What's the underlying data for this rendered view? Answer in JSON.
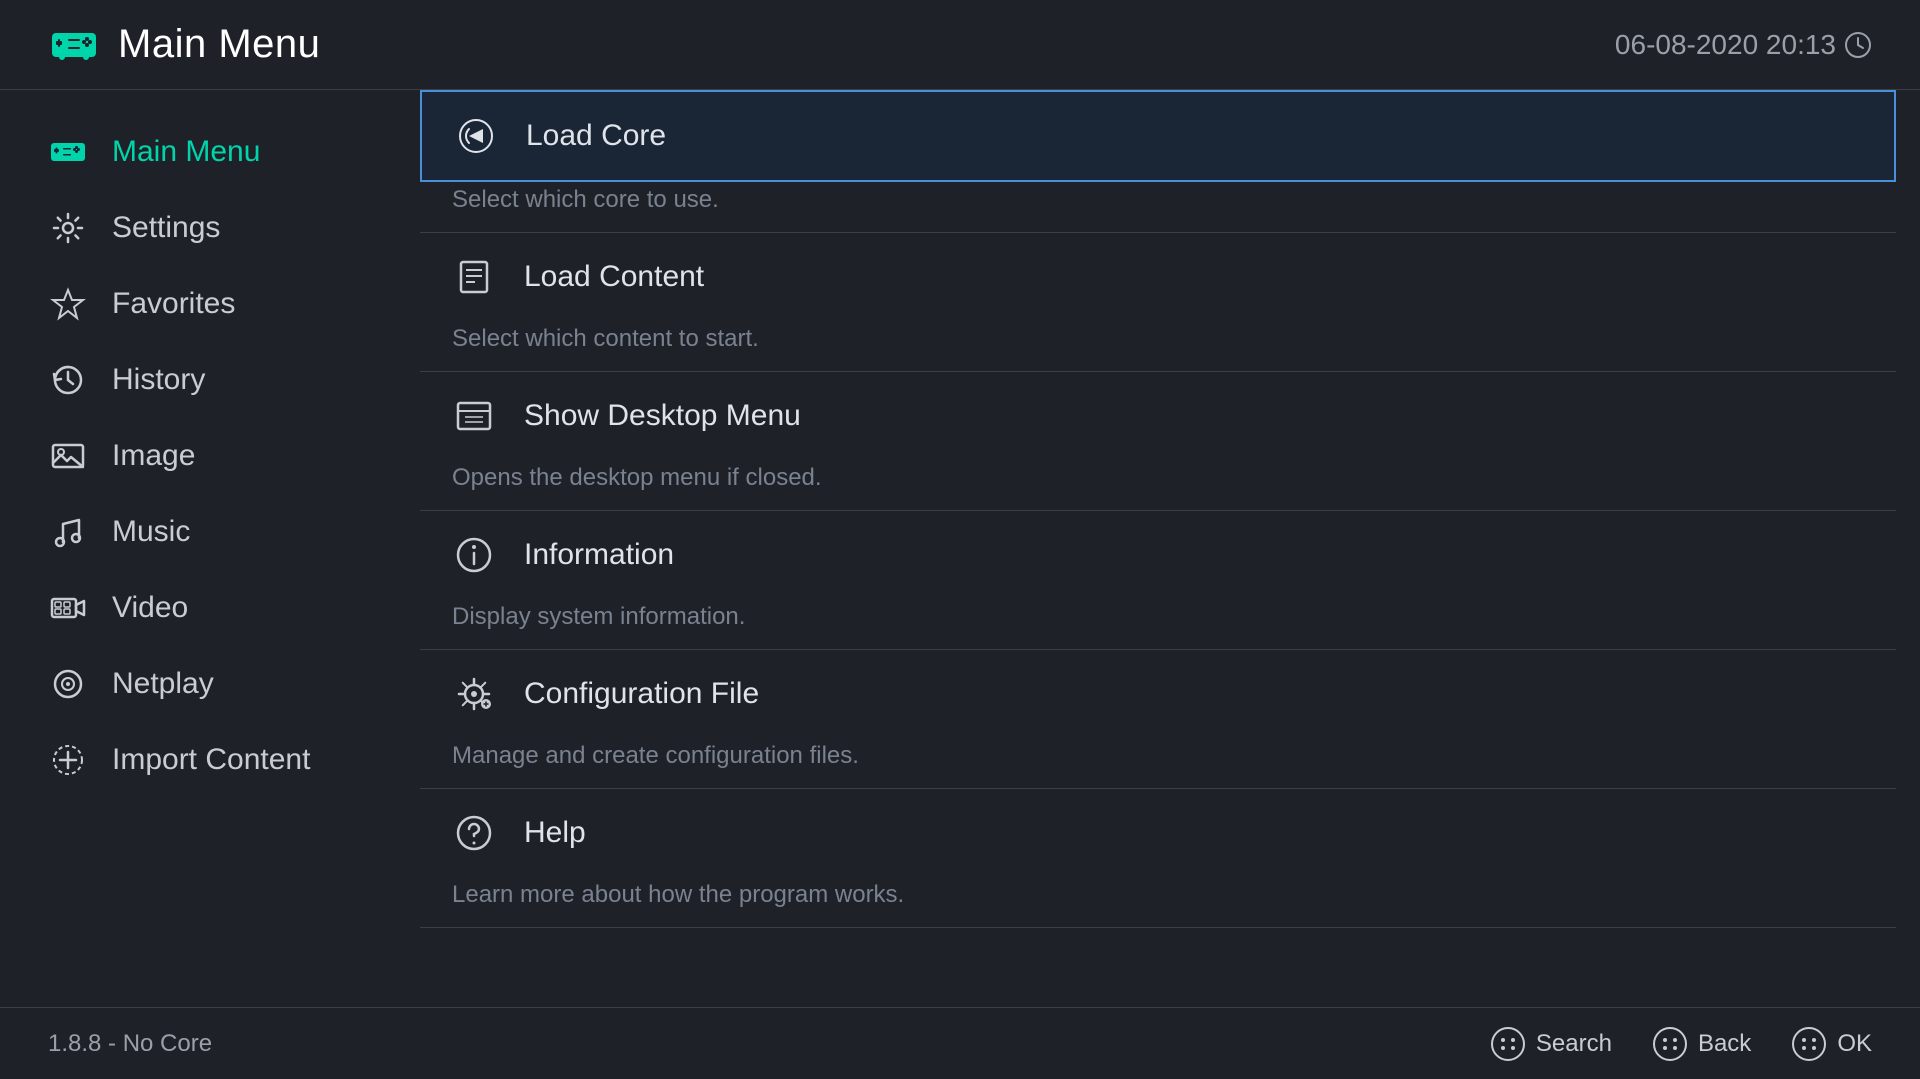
{
  "header": {
    "title": "Main Menu",
    "datetime": "06-08-2020 20:13"
  },
  "sidebar": {
    "items": [
      {
        "id": "main-menu",
        "label": "Main Menu",
        "active": true
      },
      {
        "id": "settings",
        "label": "Settings",
        "active": false
      },
      {
        "id": "favorites",
        "label": "Favorites",
        "active": false
      },
      {
        "id": "history",
        "label": "History",
        "active": false
      },
      {
        "id": "image",
        "label": "Image",
        "active": false
      },
      {
        "id": "music",
        "label": "Music",
        "active": false
      },
      {
        "id": "video",
        "label": "Video",
        "active": false
      },
      {
        "id": "netplay",
        "label": "Netplay",
        "active": false
      },
      {
        "id": "import-content",
        "label": "Import Content",
        "active": false
      }
    ]
  },
  "menu": {
    "items": [
      {
        "id": "load-core",
        "label": "Load Core",
        "description": "Select which core to use.",
        "selected": true
      },
      {
        "id": "load-content",
        "label": "Load Content",
        "description": "Select which content to start.",
        "selected": false
      },
      {
        "id": "show-desktop-menu",
        "label": "Show Desktop Menu",
        "description": "Opens the desktop menu if closed.",
        "selected": false
      },
      {
        "id": "information",
        "label": "Information",
        "description": "Display system information.",
        "selected": false
      },
      {
        "id": "configuration-file",
        "label": "Configuration File",
        "description": "Manage and create configuration files.",
        "selected": false
      },
      {
        "id": "help",
        "label": "Help",
        "description": "Learn more about how the program works.",
        "selected": false
      }
    ]
  },
  "footer": {
    "version": "1.8.8 - No Core",
    "controls": [
      {
        "id": "search",
        "label": "Search"
      },
      {
        "id": "back",
        "label": "Back"
      },
      {
        "id": "ok",
        "label": "OK"
      }
    ]
  },
  "colors": {
    "accent": "#00d4aa",
    "selected_border": "#4a90d9",
    "selected_bg": "#1a2535",
    "text_primary": "#e0e4ea",
    "text_secondary": "#7a8290",
    "text_muted": "#9aa0a8"
  }
}
